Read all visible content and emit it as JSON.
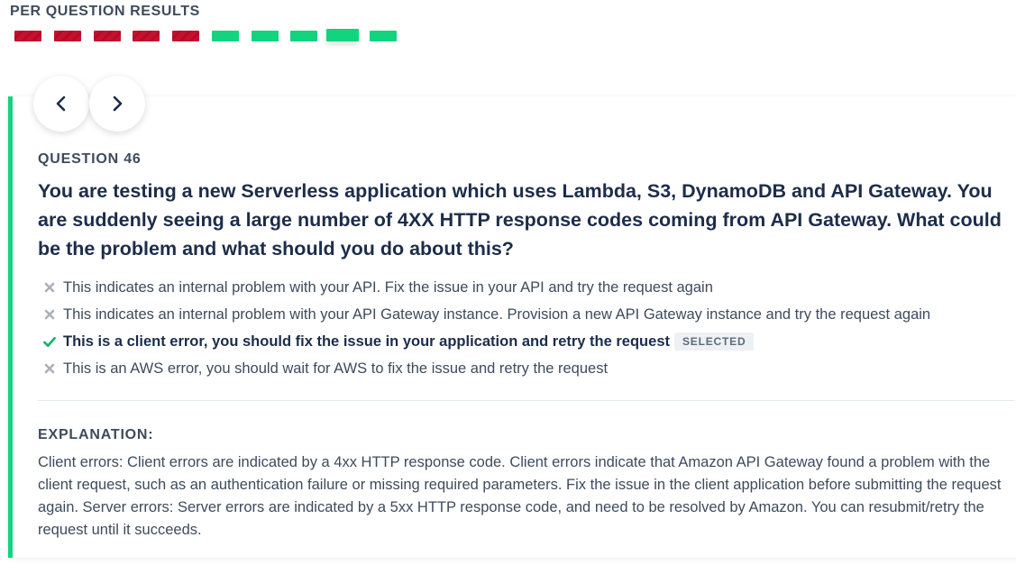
{
  "results": {
    "title": "PER QUESTION RESULTS",
    "bars": [
      "wrong",
      "wrong",
      "wrong",
      "wrong",
      "wrong",
      "correct",
      "correct",
      "correct",
      "current",
      "correct"
    ]
  },
  "question": {
    "number": "QUESTION 46",
    "text": "You are testing a new Serverless application which uses Lambda, S3, DynamoDB and API Gateway. You are suddenly seeing a large number of 4XX HTTP response codes coming from API Gateway. What could be the problem and what should you do about this?",
    "answers": [
      {
        "text": "This indicates an internal problem with your API. Fix the issue in your API and try the request again",
        "status": "incorrect"
      },
      {
        "text": "This indicates an internal problem with your API Gateway instance. Provision a new API Gateway instance and try the request again",
        "status": "incorrect"
      },
      {
        "text": "This is a client error, you should fix the issue in your application and retry the request",
        "status": "correct",
        "badge": "SELECTED"
      },
      {
        "text": "This is an AWS error, you should wait for AWS to fix the issue and retry the request",
        "status": "incorrect"
      }
    ]
  },
  "explanation": {
    "title": "EXPLANATION:",
    "text": "Client errors: Client errors are indicated by a 4xx HTTP response code. Client errors indicate that Amazon API Gateway found a problem with the client request, such as an authentication failure or missing required parameters. Fix the issue in the client application before submitting the request again. Server errors: Server errors are indicated by a 5xx HTTP response code, and need to be resolved by Amazon. You can resubmit/retry the request until it succeeds."
  },
  "nav": {
    "prev_icon": "chevron-left-icon",
    "next_icon": "chevron-right-icon"
  },
  "colors": {
    "correct": "#12d47e",
    "wrong": "#c8102e",
    "text": "#1c2d4a"
  }
}
